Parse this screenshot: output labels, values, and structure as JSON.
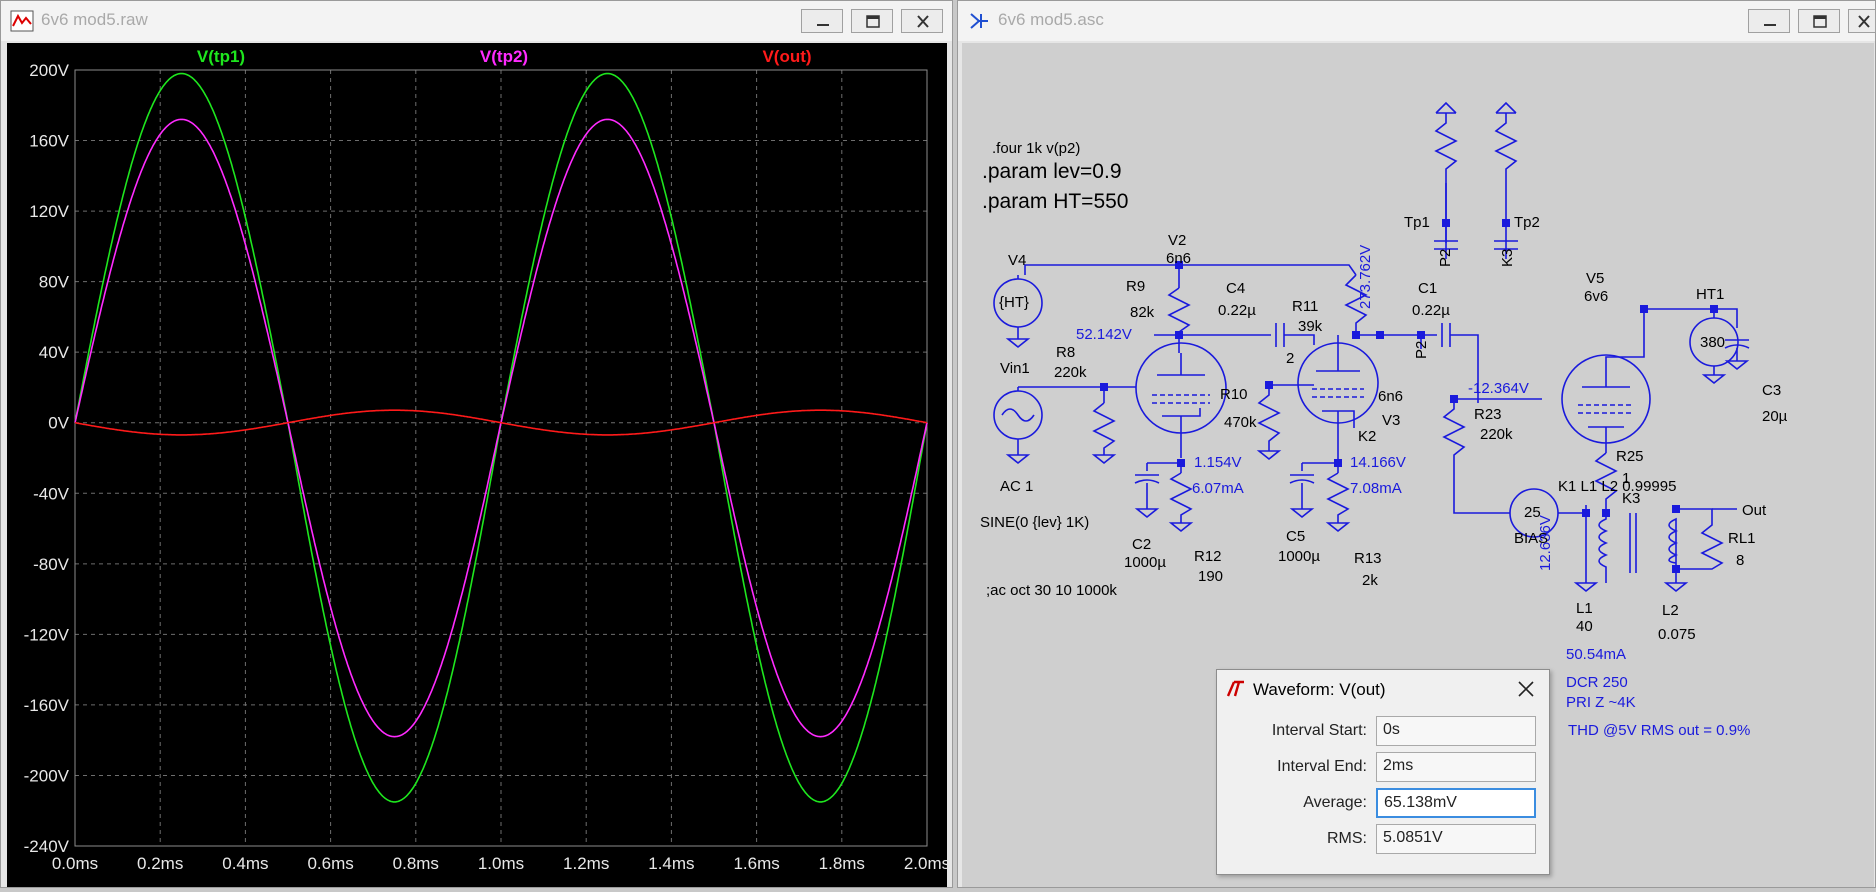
{
  "plot_window": {
    "title": "6v6 mod5.raw",
    "buttons": [
      "minimize",
      "maximize",
      "close"
    ]
  },
  "schematic_window": {
    "title": "6v6 mod5.asc",
    "buttons": [
      "minimize",
      "maximize",
      "close"
    ]
  },
  "chart_data": {
    "type": "line",
    "xlabel": "",
    "ylabel": "",
    "x_ticks": [
      "0.0ms",
      "0.2ms",
      "0.4ms",
      "0.6ms",
      "0.8ms",
      "1.0ms",
      "1.2ms",
      "1.4ms",
      "1.6ms",
      "1.8ms",
      "2.0ms"
    ],
    "y_ticks": [
      "200V",
      "160V",
      "120V",
      "80V",
      "40V",
      "0V",
      "-40V",
      "-80V",
      "-120V",
      "-160V",
      "-200V",
      "-240V"
    ],
    "xlim": [
      0,
      2.0
    ],
    "ylim": [
      -240,
      200
    ],
    "grid": true,
    "legend_placement": "top",
    "frequency_khz": 1,
    "series": [
      {
        "name": "V(tp1)",
        "color": "#1ee61e",
        "amplitude_pos": 198,
        "amplitude_neg": -215
      },
      {
        "name": "V(tp2)",
        "color": "#ff2bff",
        "amplitude_pos": 172,
        "amplitude_neg": -178
      },
      {
        "name": "V(out)",
        "color": "#ff1a1a",
        "amplitude_pos": -6.9,
        "amplitude_neg": 7.1
      }
    ]
  },
  "schematic": {
    "directives": [
      ".four 1k v(p2)",
      ".param lev=0.9",
      ".param HT=550",
      ";ac oct 30 10 1000k",
      "SINE(0 {lev} 1K)",
      "K1 L1 L2 0.99995"
    ],
    "components": {
      "V4": "V4",
      "V4_val": "{HT}",
      "Vin1": "Vin1",
      "Vin1_val": "AC 1",
      "V2": "V2",
      "V2_val": "6n6",
      "V3": "V3",
      "V3_val": "6n6",
      "V5": "V5",
      "V5_val": "6v6",
      "HT1": "HT1",
      "HT1_val": "380",
      "R9": "R9",
      "R9_val": "82k",
      "R8": "R8",
      "R8_val": "220k",
      "R10": "R10",
      "R10_val": "470k",
      "R11": "R11",
      "R11_val": "39k",
      "R12": "R12",
      "R12_val": "190",
      "R13": "R13",
      "R13_val": "2k",
      "R23": "R23",
      "R23_val": "220k",
      "R25": "R25",
      "R25_val": "1",
      "RL1": "RL1",
      "RL1_val": "8",
      "C1": "C1",
      "C1_val": "0.22µ",
      "C2": "C2",
      "C2_val": "1000µ",
      "C3": "C3",
      "C3_val": "20µ",
      "C4": "C4",
      "C4_val": "0.22µ",
      "C5": "C5",
      "C5_val": "1000µ",
      "L1": "L1",
      "L1_val": "40",
      "L2": "L2",
      "L2_val": "0.075",
      "BIAS": "BIAS",
      "BIAS_val": "25"
    },
    "net_labels": [
      "Tp1",
      "Tp2",
      "P2",
      "K3",
      "2",
      "K2",
      "Out"
    ],
    "op_values": {
      "v_52": "52.142V",
      "v_273": "273.762V",
      "v_1154": "1.154V",
      "i_607": "6.07mA",
      "v_14166": "14.166V",
      "i_708": "7.08mA",
      "v_12364": "-12.364V",
      "v_12636": "12.636V",
      "i_5054": "50.54mA"
    },
    "notes": [
      "DCR 250",
      "PRI Z ~4K",
      "THD @5V RMS out = 0.9%"
    ]
  },
  "waveform_dialog": {
    "title": "Waveform: V(out)",
    "interval_start_label": "Interval Start:",
    "interval_start": "0s",
    "interval_end_label": "Interval End:",
    "interval_end": "2ms",
    "average_label": "Average:",
    "average": "65.138mV",
    "rms_label": "RMS:",
    "rms": "5.0851V"
  }
}
